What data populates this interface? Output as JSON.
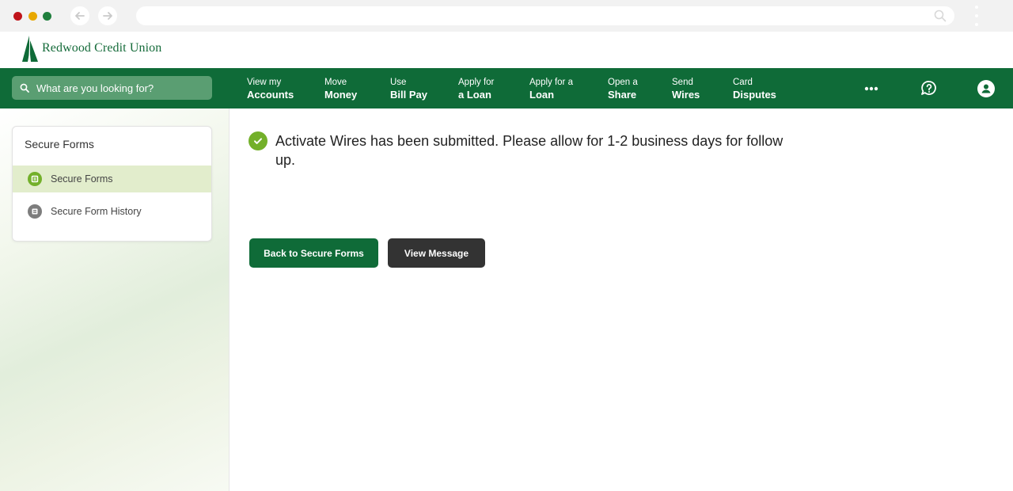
{
  "browser": {
    "url": "",
    "traffic_lights": [
      "#c0141b",
      "#e8a800",
      "#1f7f3d"
    ],
    "icons": [
      "back-arrow-icon",
      "forward-arrow-icon",
      "search-icon",
      "kebab-menu-icon"
    ]
  },
  "brand": {
    "name": "Redwood Credit Union",
    "color": "#0f6b38"
  },
  "nav": {
    "search_placeholder": "What are you looking for?",
    "items": [
      {
        "line1": "View my",
        "line2": "Accounts"
      },
      {
        "line1": "Move",
        "line2": "Money"
      },
      {
        "line1": "Use",
        "line2": "Bill Pay"
      },
      {
        "line1": "Apply for",
        "line2": "a Loan"
      },
      {
        "line1": "Apply for a",
        "line2": "Loan"
      },
      {
        "line1": "Open a",
        "line2": "Share"
      },
      {
        "line1": "Send",
        "line2": "Wires"
      },
      {
        "line1": "Card",
        "line2": "Disputes"
      }
    ],
    "right_icons": [
      "more-icon",
      "help-chat-icon",
      "user-avatar-icon"
    ]
  },
  "sidebar": {
    "title": "Secure Forms",
    "items": [
      {
        "label": "Secure Forms",
        "active": true,
        "icon": "form-icon"
      },
      {
        "label": "Secure Form History",
        "active": false,
        "icon": "history-list-icon"
      }
    ]
  },
  "content": {
    "message": "Activate Wires has been submitted. Please allow for 1-2 business days for follow up.",
    "status_icon": "success-check-icon",
    "status_color": "#73b02a",
    "buttons": {
      "back_label": "Back to Secure Forms",
      "view_label": "View Message"
    }
  }
}
